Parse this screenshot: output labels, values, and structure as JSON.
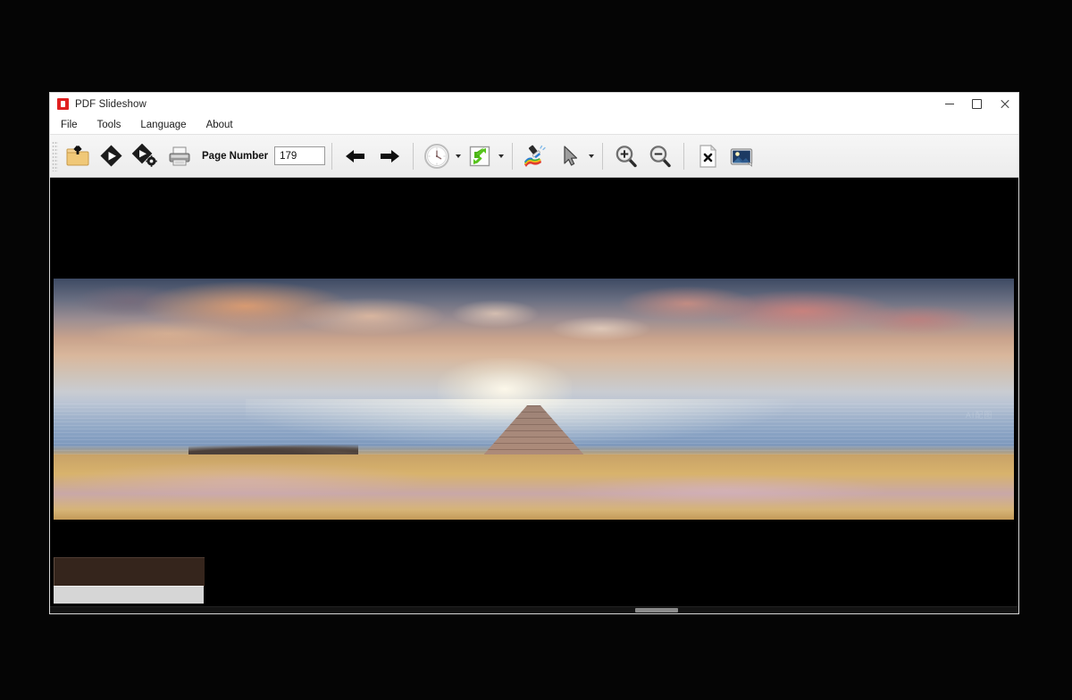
{
  "window": {
    "title": "PDF Slideshow",
    "app_icon": "pdf-document-icon",
    "controls": {
      "minimize": "Minimize",
      "maximize": "Maximize",
      "close": "Close"
    }
  },
  "menubar": {
    "items": [
      {
        "label": "File",
        "name": "menu-file"
      },
      {
        "label": "Tools",
        "name": "menu-tools"
      },
      {
        "label": "Language",
        "name": "menu-language"
      },
      {
        "label": "About",
        "name": "menu-about"
      }
    ]
  },
  "toolbar": {
    "grip": "toolbar-grip",
    "buttons": [
      {
        "name": "open-file-button",
        "icon": "folder-open-icon",
        "tooltip": "Open"
      },
      {
        "name": "start-slideshow-button",
        "icon": "play-diamond-icon",
        "tooltip": "Start Slideshow"
      },
      {
        "name": "slideshow-settings-button",
        "icon": "play-diamond-gear-icon",
        "tooltip": "Slideshow Settings"
      },
      {
        "name": "print-button",
        "icon": "printer-icon",
        "tooltip": "Print"
      },
      {
        "name": "previous-page-button",
        "icon": "arrow-left-icon",
        "tooltip": "Previous Page"
      },
      {
        "name": "next-page-button",
        "icon": "arrow-right-icon",
        "tooltip": "Next Page"
      },
      {
        "name": "timer-button",
        "icon": "clock-icon",
        "tooltip": "Timer",
        "has_dropdown": true
      },
      {
        "name": "rotate-fullscreen-button",
        "icon": "green-rotate-icon",
        "tooltip": "Rotate / Fit",
        "has_dropdown": true
      },
      {
        "name": "stamp-tool-button",
        "icon": "stamp-color-icon",
        "tooltip": "Stamp Tool"
      },
      {
        "name": "pointer-tool-button",
        "icon": "cursor-arrow-icon",
        "tooltip": "Pointer Tool",
        "has_dropdown": true
      },
      {
        "name": "zoom-in-button",
        "icon": "magnifier-plus-icon",
        "tooltip": "Zoom In"
      },
      {
        "name": "zoom-out-button",
        "icon": "magnifier-minus-icon",
        "tooltip": "Zoom Out"
      },
      {
        "name": "close-document-button",
        "icon": "page-close-icon",
        "tooltip": "Close Document"
      },
      {
        "name": "export-image-button",
        "icon": "picture-icon",
        "tooltip": "Export Image"
      }
    ],
    "page_number": {
      "label": "Page Number",
      "value": "179",
      "placeholder": "0"
    }
  },
  "viewer": {
    "background_color": "#000000",
    "page_image": {
      "name": "pdf-page-image",
      "description": "Sunset seascape with wooden pier extending toward the horizon",
      "watermark": "AI配图"
    },
    "overlay_panel": {
      "name": "annotation-overlay-panel"
    },
    "overlay_bar": {
      "name": "annotation-overlay-bar"
    },
    "scrollbar": {
      "name": "horizontal-scrollbar",
      "thumb": "horizontal-scrollbar-thumb"
    }
  }
}
